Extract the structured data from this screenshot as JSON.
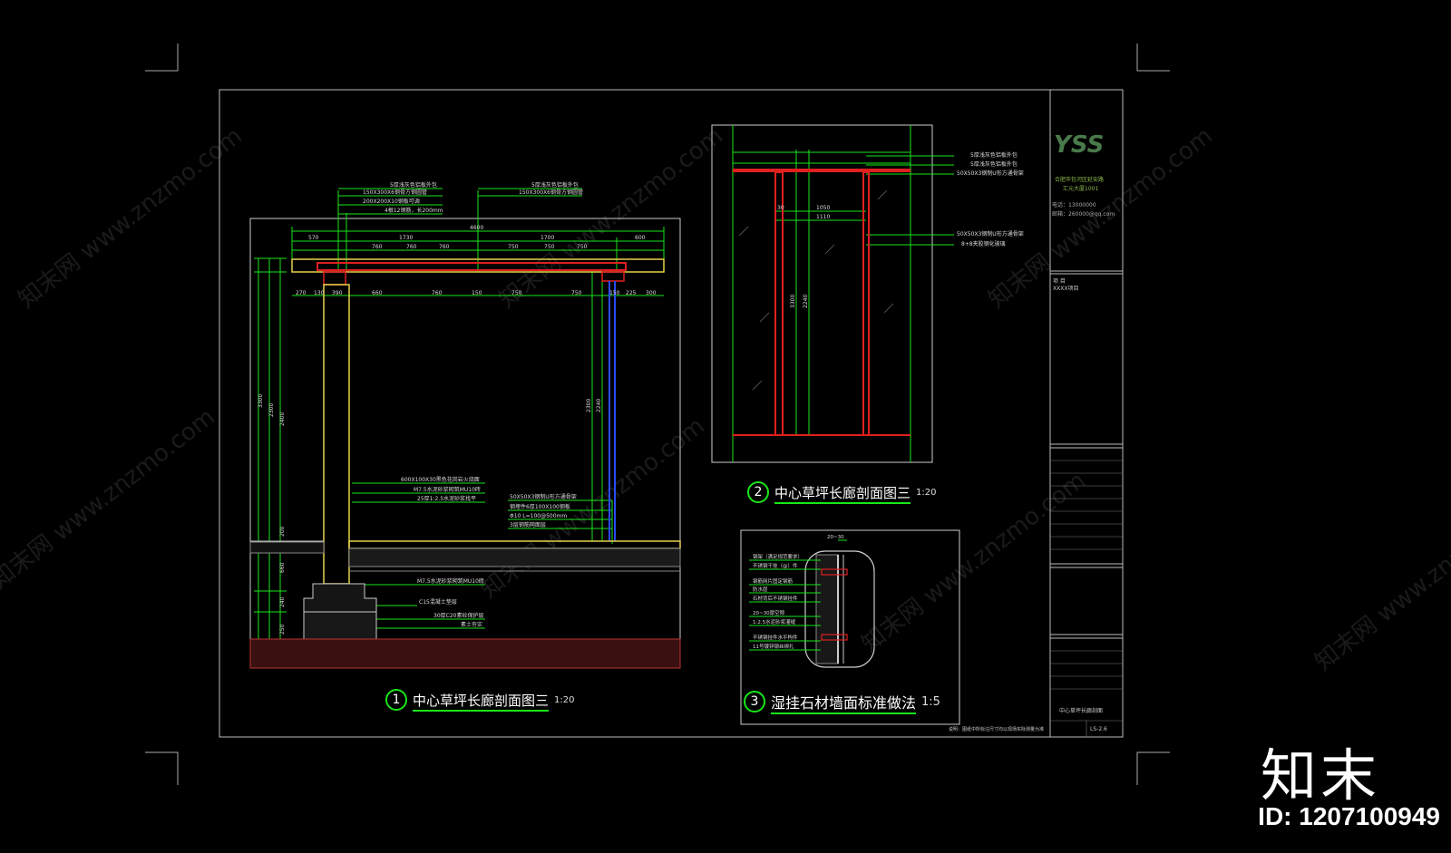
{
  "titles": {
    "t1_num": "1",
    "t1_text": "中心草坪长廊剖面图三",
    "t1_scale": "1:20",
    "t2_num": "2",
    "t2_text": "中心草坪长廊剖面图三",
    "t2_scale": "1:20",
    "t3_num": "3",
    "t3_text": "湿挂石材墙面标准做法",
    "t3_scale": "1:5"
  },
  "dims": {
    "total": "4600",
    "seg_a": "570",
    "seg_b": "1730",
    "seg_c": "1700",
    "seg_d": "600",
    "s1": "760",
    "s2": "760",
    "s3": "760",
    "s4": "750",
    "s5": "750",
    "s6": "750",
    "b1": "270",
    "b2": "130",
    "b3": "390",
    "b4": "660",
    "b5": "760",
    "b6": "150",
    "b7": "750",
    "b8": "750",
    "b9": "150",
    "b10": "225",
    "b11": "300",
    "v1": "3300",
    "v2": "2300",
    "v3": "2400",
    "v4": "200",
    "v5": "660",
    "v6": "240",
    "v7": "250",
    "r1": "2300",
    "r2": "2240",
    "d2_a": "1050",
    "d2_b": "1110",
    "d2_c": "3300",
    "d2_d": "2240",
    "d2_e": "30",
    "d3_a": "20~30"
  },
  "notes_top_left": [
    "5厚浅灰色铝板外包",
    "150X300X6钢骨方钢圆管",
    "200X200X10钢板可调",
    "4根12钢筋，长200mm"
  ],
  "notes_top_right": [
    "5厚浅灰色铝板外包",
    "150X300X6钢骨方钢圆管"
  ],
  "notes_mid": [
    "600X100X30黑色花岗岩火烧面",
    "M7.5水泥砂浆砌筑MU10砖",
    "25厚1:2.5水泥砂浆找平"
  ],
  "notes_mid2": [
    "50X50X3钢制U形方通骨架",
    "钢埋件6厚100X100钢板",
    "Φ10 L=100@500mm",
    "3层钢筋网面层"
  ],
  "notes_bottom": [
    "M7.5水泥砂浆砌筑MU10砖",
    "C15混凝土垫层",
    "30厚C20素砼保护层",
    "素土夯实"
  ],
  "notes_s2": [
    "5厚浅灰色铝板外包",
    "5厚浅灰色铝板外包",
    "50X50X3钢制U形方通骨架",
    "50X50X3钢制U形方通骨架",
    "8+8夹胶钢化玻璃"
  ],
  "notes_s3": [
    "钢架（满足规范要求）",
    "不锈钢干挂（@）件",
    "钢筋网片固定钢筋",
    "防水层",
    "石材背后不锈钢挂件",
    "20~30厚空隙",
    "1:2.5水泥砂浆灌缝",
    "不锈钢挂件水平构件",
    "11号镀锌钢丝绑扎"
  ],
  "titleblock": {
    "logo": "YSS",
    "company": "合肥市包河区延安路",
    "company2": "汇元大厦1001",
    "row1": "电话：13000000",
    "row2": "邮箱：260000@qq.com",
    "project_lbl": "项  目",
    "project_val": "XXXX项目",
    "sheet_name": "中心草坪长廊剖面",
    "sheet_no": "LS-2.6",
    "footer_note": "说明：图纸中所标注尺寸均以现场实际测量为准"
  },
  "brand": "知末",
  "id_text": "ID: 1207100949",
  "watermark": "知末网 www.znzmo.com"
}
